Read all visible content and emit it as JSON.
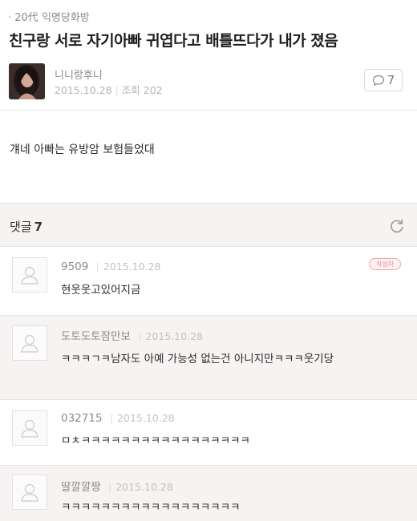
{
  "post": {
    "board": "20代 익명당화방",
    "title": "친구랑 서로 자기아빠 귀엽다고 배틀뜨다가 내가 졌음",
    "author": "니니랑후니",
    "date": "2015.10.28",
    "views": "조회 202",
    "comment_count": "7",
    "body": "걔네 아빠는 유방암 보험들었대"
  },
  "comments_section": {
    "label": "댓글",
    "count": "7"
  },
  "comments": [
    {
      "name": "9509",
      "date": "2015.10.28",
      "text": "현웃웃고있어지금",
      "badge": "작성자"
    },
    {
      "name": "도토도토잠만보",
      "date": "2015.10.28",
      "text": "ㅋㅋㅋㄱㅋ남자도 아예 가능성 없는건 아니지만ㅋㅋㅋ웃기당"
    },
    {
      "name": "032715",
      "date": "2015.10.28",
      "text": "ㅁㅊㅋㅋㅋㅋㅋㅋㅋㅋㅋㅋㅋㅋㅋㅋㅋㅋㅋ"
    },
    {
      "name": "딸깔깔짱",
      "date": "2015.10.28",
      "text": "ㅋㅋㅋㅋㅋㅋㅋㅋㅋㅋㅋㅋㅋㅋㅋㅋㅋㅋ"
    }
  ]
}
